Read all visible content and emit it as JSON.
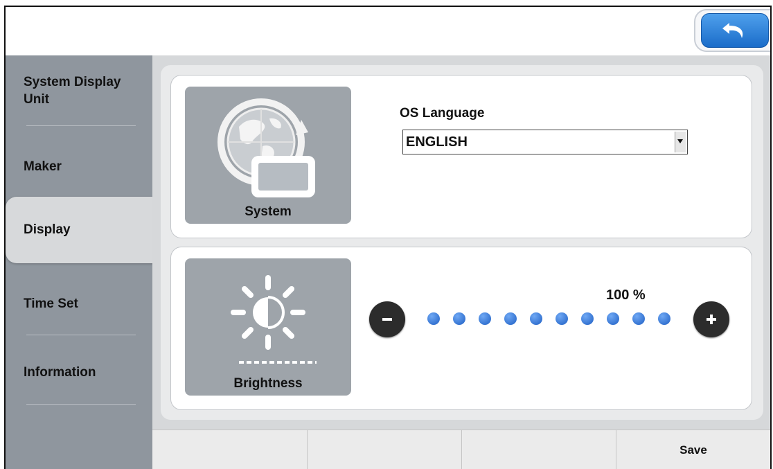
{
  "topbar": {
    "back_icon": "back-arrow-icon",
    "accent": "#2f86e0"
  },
  "sidebar": {
    "items": [
      {
        "label": "System Display\nUnit"
      },
      {
        "label": "Maker"
      },
      {
        "label": "Display",
        "active": true
      },
      {
        "label": "Time Set"
      },
      {
        "label": "Information"
      }
    ]
  },
  "system_card": {
    "tile_label": "System",
    "tile_icon": "globe-display-icon",
    "os_language_label": "OS Language",
    "language_value": "ENGLISH"
  },
  "brightness_card": {
    "tile_label": "Brightness",
    "tile_icon": "sun-brightness-icon",
    "percent_label": "100 %",
    "level_steps_total": 10,
    "level_steps_filled": 10,
    "minus_label": "-",
    "plus_label": "+"
  },
  "bottombar": {
    "buttons": [
      "",
      "",
      "",
      "Save"
    ]
  },
  "colors": {
    "sidebar_bg": "#8f969e",
    "tile_bg": "#9ea4aa",
    "dot_blue": "#2a6fd3"
  }
}
